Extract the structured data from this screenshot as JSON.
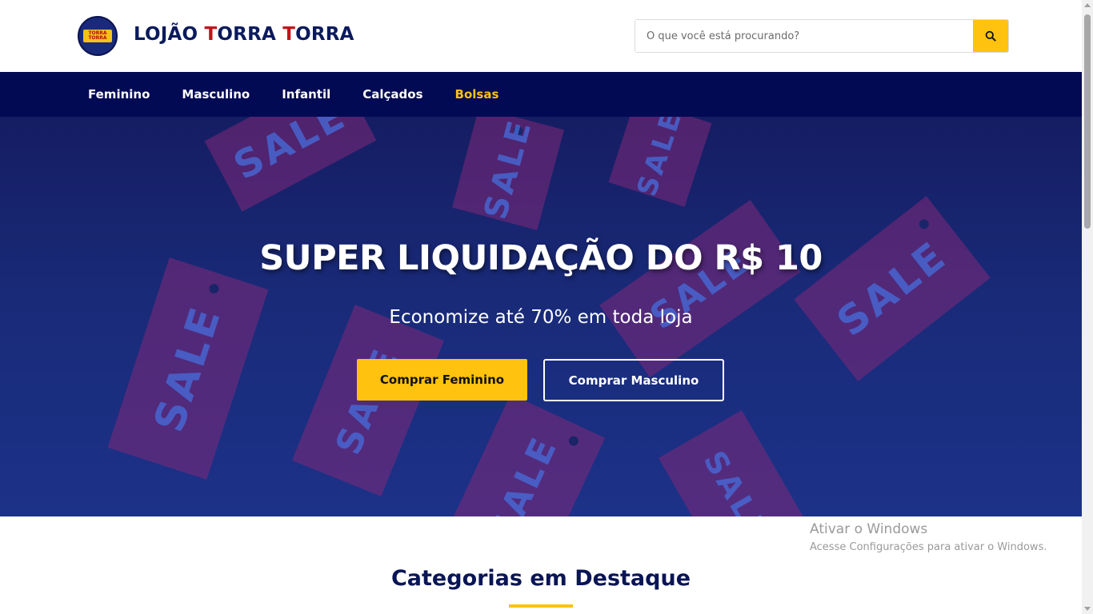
{
  "header": {
    "brand_part1": "LOJÃO ",
    "brand_t1": "T",
    "brand_part2": "ORRA ",
    "brand_t2": "T",
    "brand_part3": "ORRA",
    "logo_text": "TORRA TORRA",
    "search": {
      "placeholder": "O que você está procurando?",
      "value": ""
    },
    "search_icon": "search-icon"
  },
  "nav": {
    "items": [
      {
        "label": "Feminino"
      },
      {
        "label": "Masculino"
      },
      {
        "label": "Infantil"
      },
      {
        "label": "Calçados"
      },
      {
        "label": "Bolsas"
      }
    ],
    "active": "Bolsas"
  },
  "hero": {
    "tag_text": "SALE",
    "title": "SUPER LIQUIDAÇÃO DO R$ 10",
    "subtitle": "Economize até 70% em toda loja",
    "button_primary": "Comprar Feminino",
    "button_secondary": "Comprar Masculino"
  },
  "categories": {
    "title": "Categorias em Destaque"
  },
  "watermark": {
    "line1": "Ativar o Windows",
    "line2": "Acesse Configurações para ativar o Windows."
  },
  "colors": {
    "navy": "#020a54",
    "accent_yellow": "#ffc20e",
    "brand_red": "#c4121a",
    "hero_bg": "#192a78"
  }
}
